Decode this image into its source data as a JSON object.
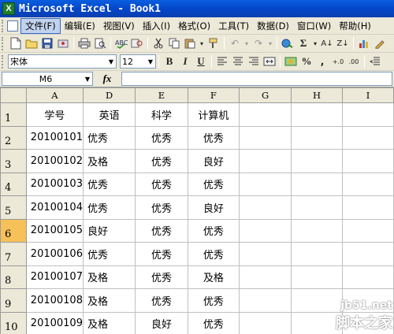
{
  "window": {
    "title": "Microsoft Excel - Book1",
    "icon": "excel-icon"
  },
  "menu": [
    "文件(F)",
    "编辑(E)",
    "视图(V)",
    "插入(I)",
    "格式(O)",
    "工具(T)",
    "数据(D)",
    "窗口(W)",
    "帮助(H)"
  ],
  "toolbar": {
    "font_name": "宋体",
    "font_size": "12",
    "bold_label": "B",
    "italic_label": "I",
    "underline_label": "U",
    "sigma_label": "Σ",
    "percent_label": "%"
  },
  "formula_bar": {
    "name_box": "M6",
    "fx_label": "fx",
    "formula": ""
  },
  "sheet": {
    "column_headers": [
      "A",
      "D",
      "E",
      "F",
      "G",
      "H",
      "I"
    ],
    "row_numbers": [
      "1",
      "2",
      "3",
      "4",
      "5",
      "6",
      "7",
      "8",
      "9",
      "10"
    ],
    "selected_row": "6",
    "header_row": [
      "学号",
      "英语",
      "科学",
      "计算机"
    ],
    "rows": [
      [
        "20100101",
        "优秀",
        "优秀",
        "优秀"
      ],
      [
        "20100102",
        "及格",
        "优秀",
        "良好"
      ],
      [
        "20100103",
        "优秀",
        "优秀",
        "优秀"
      ],
      [
        "20100104",
        "优秀",
        "优秀",
        "良好"
      ],
      [
        "20100105",
        "良好",
        "优秀",
        "优秀"
      ],
      [
        "20100106",
        "优秀",
        "优秀",
        "优秀"
      ],
      [
        "20100107",
        "及格",
        "优秀",
        "及格"
      ],
      [
        "20100108",
        "及格",
        "优秀",
        "优秀"
      ],
      [
        "20100109",
        "及格",
        "良好",
        "优秀"
      ]
    ]
  },
  "watermark": {
    "line1": "jb51.net",
    "line2": "脚本之家"
  },
  "colors": {
    "titlebar": "#0445c8",
    "toolbar_bg": "#ece9d8",
    "selected_row_header": "#f7c15a",
    "gridline": "#c0c0c0"
  }
}
